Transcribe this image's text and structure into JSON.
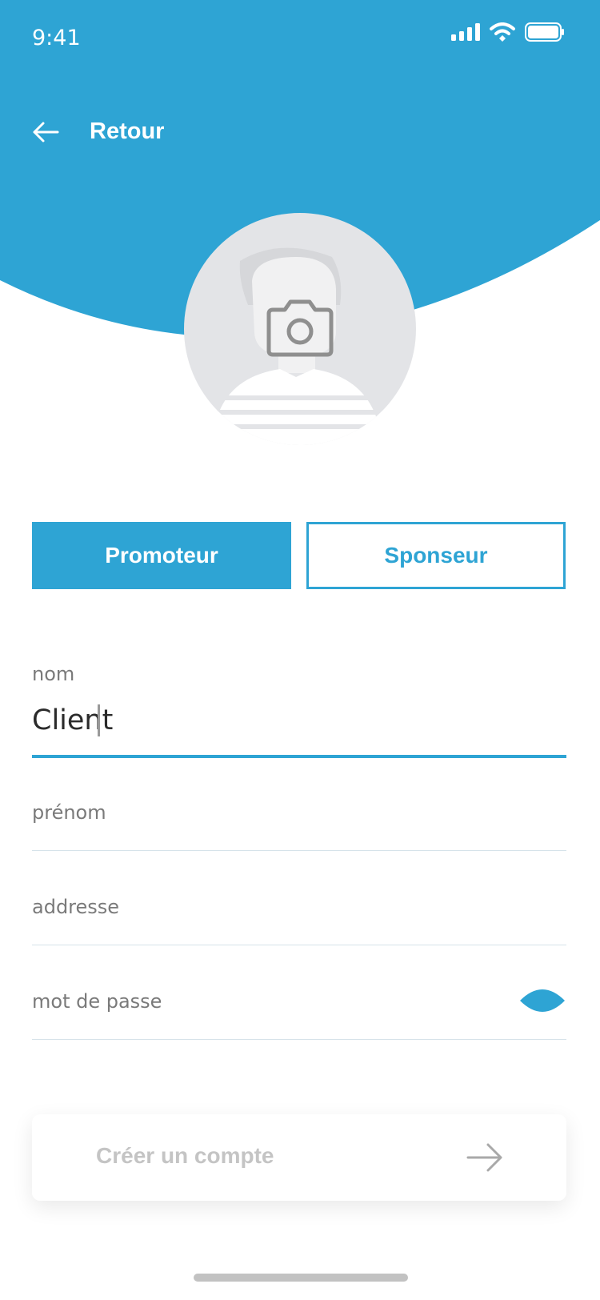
{
  "colors": {
    "accent": "#2ea4d4",
    "muted_text": "#7a7a7a",
    "disabled_text": "#c4c4c4"
  },
  "status_bar": {
    "time": "9:41",
    "icons": [
      "signal-icon",
      "wifi-icon",
      "battery-icon"
    ]
  },
  "nav": {
    "back_label": "Retour",
    "back_icon": "arrow-left-icon"
  },
  "avatar": {
    "icon": "camera-icon"
  },
  "role_toggle": {
    "selected": "Promoteur",
    "options": [
      "Promoteur",
      "Sponseur"
    ]
  },
  "form": {
    "nom": {
      "label": "nom",
      "value": "Client"
    },
    "prenom": {
      "label": "prénom",
      "value": ""
    },
    "adresse": {
      "label": "addresse",
      "value": ""
    },
    "mot_de_passe": {
      "label": "mot de passe",
      "value": "",
      "toggle_icon": "eye-icon"
    }
  },
  "cta": {
    "label": "Créer un compte",
    "icon": "arrow-right-icon"
  }
}
